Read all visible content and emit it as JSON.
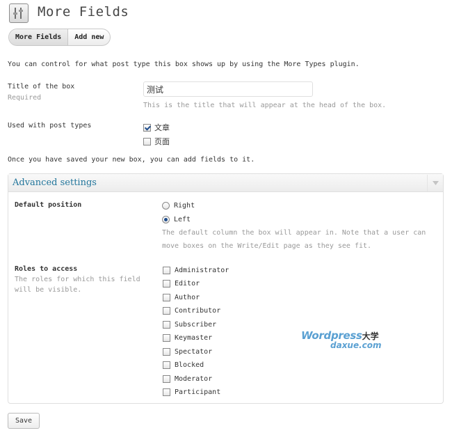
{
  "page": {
    "title": "More Fields",
    "icon": "fields-settings-icon"
  },
  "tabs": [
    {
      "label": "More Fields",
      "active": true
    },
    {
      "label": "Add new",
      "active": false
    }
  ],
  "intro_text": "You can control for what post type this box shows up by using the More Types plugin.",
  "title_field": {
    "label": "Title of the box",
    "required": "Required",
    "value": "测试",
    "hint": "This is the title that will appear at the head of the box."
  },
  "post_types": {
    "label": "Used with post types",
    "options": [
      {
        "label": "文章",
        "checked": true
      },
      {
        "label": "页面",
        "checked": false
      }
    ]
  },
  "after_save_text": "Once you have saved your new box, you can add fields to it.",
  "advanced": {
    "title": "Advanced settings",
    "position": {
      "label": "Default position",
      "options": [
        {
          "label": "Right",
          "checked": false
        },
        {
          "label": "Left",
          "checked": true
        }
      ],
      "hint_line1": "The default column the box will appear in. Note that a user can",
      "hint_line2": "move boxes on the Write/Edit page as they see fit."
    },
    "roles": {
      "label": "Roles to access",
      "desc_line1": "The roles for which this field",
      "desc_line2": "will be visible.",
      "options": [
        {
          "label": "Administrator",
          "checked": false
        },
        {
          "label": "Editor",
          "checked": false
        },
        {
          "label": "Author",
          "checked": false
        },
        {
          "label": "Contributor",
          "checked": false
        },
        {
          "label": "Subscriber",
          "checked": false
        },
        {
          "label": "Keymaster",
          "checked": false
        },
        {
          "label": "Spectator",
          "checked": false
        },
        {
          "label": "Blocked",
          "checked": false
        },
        {
          "label": "Moderator",
          "checked": false
        },
        {
          "label": "Participant",
          "checked": false
        }
      ]
    }
  },
  "save_label": "Save",
  "watermark": {
    "top": "Wordpress",
    "cn": "大学",
    "bottom": "daxue.com"
  },
  "colors": {
    "link": "#21759b",
    "watermark": "#5aa0d2"
  }
}
